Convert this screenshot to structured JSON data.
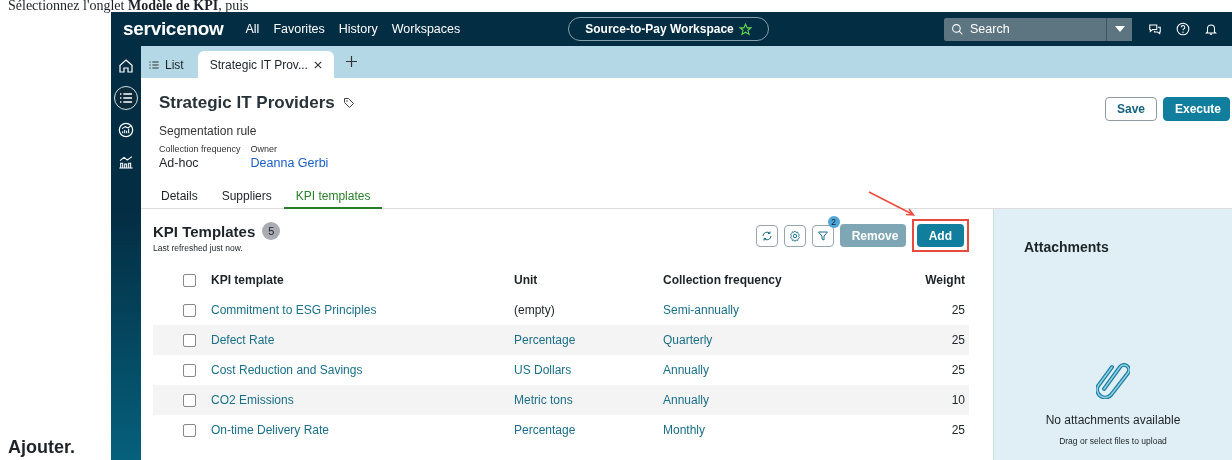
{
  "document": {
    "intro": "Sélectionnez l'onglet **Modèle de KPI**, puis",
    "ending": "Ajouter."
  },
  "top_bar": {
    "logo": "servicenow",
    "menu": [
      {
        "label": "All"
      },
      {
        "label": "Favorites"
      },
      {
        "label": "History"
      },
      {
        "label": "Workspaces"
      }
    ],
    "workspace": "Source-to-Pay Workspace",
    "search": {
      "placeholder": "Search"
    }
  },
  "rail": [
    {
      "kind": "home",
      "selected": false
    },
    {
      "kind": "list",
      "selected": true
    },
    {
      "kind": "gauge",
      "selected": false
    },
    {
      "kind": "analytics",
      "selected": false
    }
  ],
  "tabs": [
    {
      "label": "List",
      "kind": "list",
      "selected": false
    },
    {
      "label": "Strategic IT Prov...",
      "kind": "record",
      "selected": true
    }
  ],
  "record": {
    "title": "Strategic IT Providers",
    "type": "Segmentation rule",
    "fields": [
      {
        "label": "Collection frequency",
        "value": "Ad-hoc",
        "link": false
      },
      {
        "label": "Owner",
        "value": "Deanna Gerbi",
        "link": true
      }
    ],
    "buttons": [
      {
        "label": "Save",
        "kind": "secondary"
      },
      {
        "label": "Execute",
        "kind": "primary"
      }
    ]
  },
  "section_tabs": [
    {
      "label": "Details",
      "selected": false
    },
    {
      "label": "Suppliers",
      "selected": false
    },
    {
      "label": "KPI templates",
      "selected": true
    }
  ],
  "list": {
    "title": "KPI Templates",
    "count": "5",
    "refreshed": "Last refreshed just now.",
    "filter_count": "2",
    "all_checked": false,
    "buttons": [
      {
        "label": "Remove",
        "disabled": true,
        "highlighted": false
      },
      {
        "label": "Add",
        "disabled": false,
        "highlighted": true
      }
    ],
    "columns": [
      "KPI template",
      "Unit",
      "Collection frequency",
      "Weight"
    ],
    "rows": [
      {
        "checked": false,
        "kpi_template": "Commitment to ESG Principles",
        "unit": "(empty)",
        "unit_link": false,
        "collection_frequency": "Semi-annually",
        "weight": "25"
      },
      {
        "checked": false,
        "kpi_template": "Defect Rate",
        "unit": "Percentage",
        "unit_link": true,
        "collection_frequency": "Quarterly",
        "weight": "25"
      },
      {
        "checked": false,
        "kpi_template": "Cost Reduction and Savings",
        "unit": "US Dollars",
        "unit_link": true,
        "collection_frequency": "Annually",
        "weight": "25"
      },
      {
        "checked": false,
        "kpi_template": "CO2 Emissions",
        "unit": "Metric tons",
        "unit_link": true,
        "collection_frequency": "Annually",
        "weight": "10"
      },
      {
        "checked": false,
        "kpi_template": "On-time Delivery Rate",
        "unit": "Percentage",
        "unit_link": true,
        "collection_frequency": "Monthly",
        "weight": "25"
      }
    ]
  },
  "attachments": {
    "title": "Attachments",
    "empty": "No attachments available",
    "hint": "Drag or select files to upload"
  }
}
